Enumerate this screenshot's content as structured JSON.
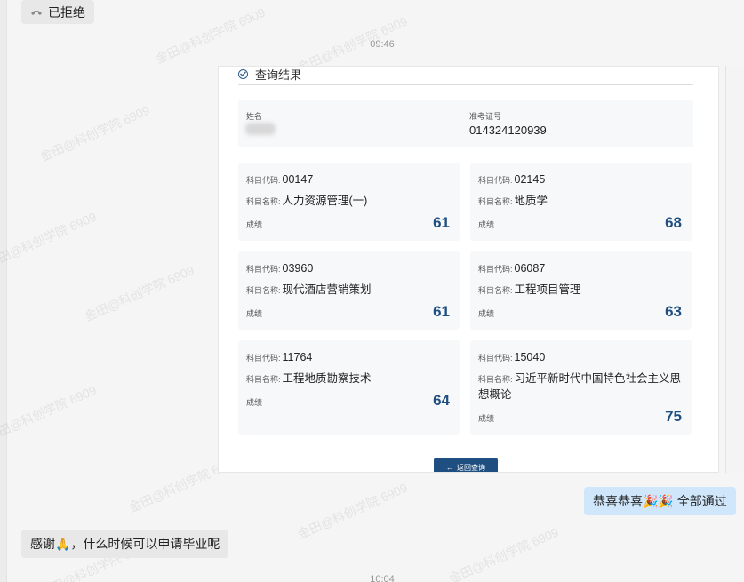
{
  "chat": {
    "rejected_label": "已拒绝",
    "time1": "09:46",
    "sent_message": "恭喜恭喜🎉🎉  全部通过",
    "reply_text": "感谢🙏，什么时候可以申请毕业呢",
    "time2": "10:04"
  },
  "card": {
    "header": "查询结果",
    "name_label": "姓名",
    "ticket_label": "准考证号",
    "ticket_value": "014324120939",
    "code_label": "科目代码:",
    "subject_label": "科目名称:",
    "score_label": "成绩",
    "subjects": [
      {
        "code": "00147",
        "name": "人力资源管理(一)",
        "score": "61"
      },
      {
        "code": "02145",
        "name": "地质学",
        "score": "68"
      },
      {
        "code": "03960",
        "name": "现代酒店营销策划",
        "score": "61"
      },
      {
        "code": "06087",
        "name": "工程项目管理",
        "score": "63"
      },
      {
        "code": "11764",
        "name": "工程地质勘察技术",
        "score": "64"
      },
      {
        "code": "15040",
        "name": "习近平新时代中国特色社会主义思想概论",
        "score": "75"
      }
    ],
    "back_button": "返回查询"
  },
  "watermark": "金田@科创学院 6909",
  "colors": {
    "accent": "#1f4f80",
    "out_bubble": "#cfe6fb",
    "in_bubble": "#e8e8e8"
  }
}
